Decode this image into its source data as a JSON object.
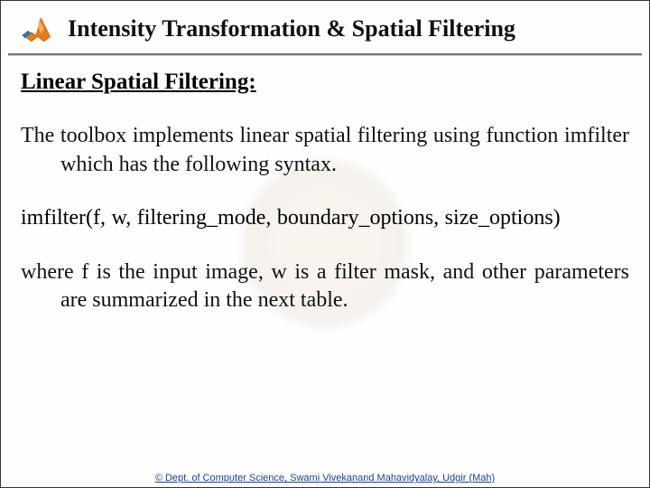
{
  "header": {
    "title": "Intensity Transformation & Spatial Filtering"
  },
  "content": {
    "subheading": "Linear Spatial Filtering:",
    "paragraph1": "The toolbox implements linear spatial filtering using function imfilter which has the following syntax.",
    "syntax": "imfilter(f, w, filtering_mode, boundary_options, size_options)",
    "paragraph2": "where f is the input image, w is a filter mask, and other parameters are summarized in the next table."
  },
  "footer": {
    "text": "© Dept. of Computer Science, Swami Vivekanand Mahavidyalay, Udgir (Mah)"
  }
}
